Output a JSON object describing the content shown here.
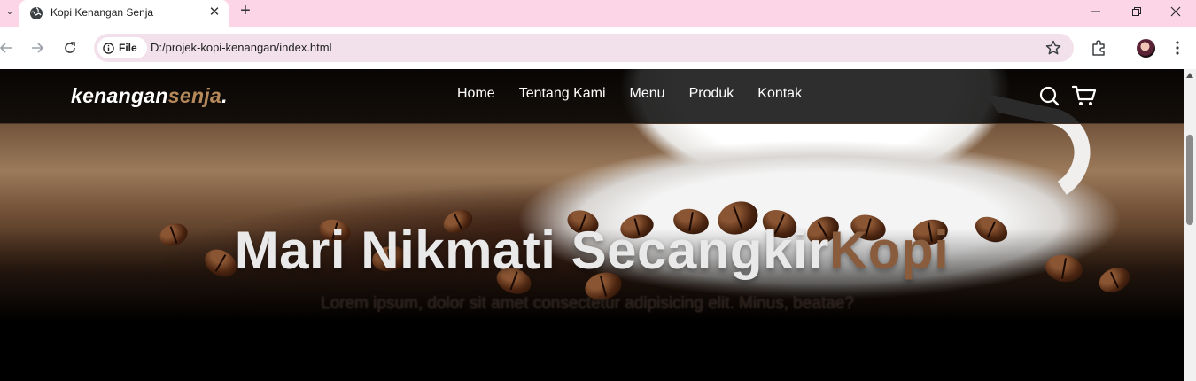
{
  "browser": {
    "tab_title": "Kopi Kenangan Senja",
    "tab_close": "✕",
    "new_tab": "+",
    "chip_label": "File",
    "url": "D:/projek-kopi-kenangan/index.html",
    "window_controls": {
      "minimize": "—",
      "maximize": "❐",
      "close": "✕"
    },
    "icons": [
      "tab-search-icon",
      "globe-icon",
      "back-arrow-icon",
      "forward-arrow-icon",
      "reload-icon",
      "info-icon",
      "bookmark-star-icon",
      "extensions-icon",
      "profile-avatar",
      "kebab-menu-icon"
    ]
  },
  "site": {
    "logo_main": "kenangan",
    "logo_accent": "senja",
    "logo_dot": ".",
    "nav": [
      {
        "label": "Home"
      },
      {
        "label": "Tentang Kami"
      },
      {
        "label": "Menu"
      },
      {
        "label": "Produk"
      },
      {
        "label": "Kontak"
      }
    ],
    "nav_icons": [
      "search-icon",
      "shopping-cart-icon"
    ],
    "hero": {
      "title_main": "Mari Nikmati Secangkir",
      "title_accent": "Kopi",
      "subtitle": "Lorem ipsum, dolor sit amet consectetur adipisicing elit. Minus, beatae?"
    }
  },
  "colors": {
    "tabbar": "#fcd5e6",
    "omnibox": "#f2e1ea",
    "accent": "#b6895b",
    "navbar": "#000000"
  }
}
